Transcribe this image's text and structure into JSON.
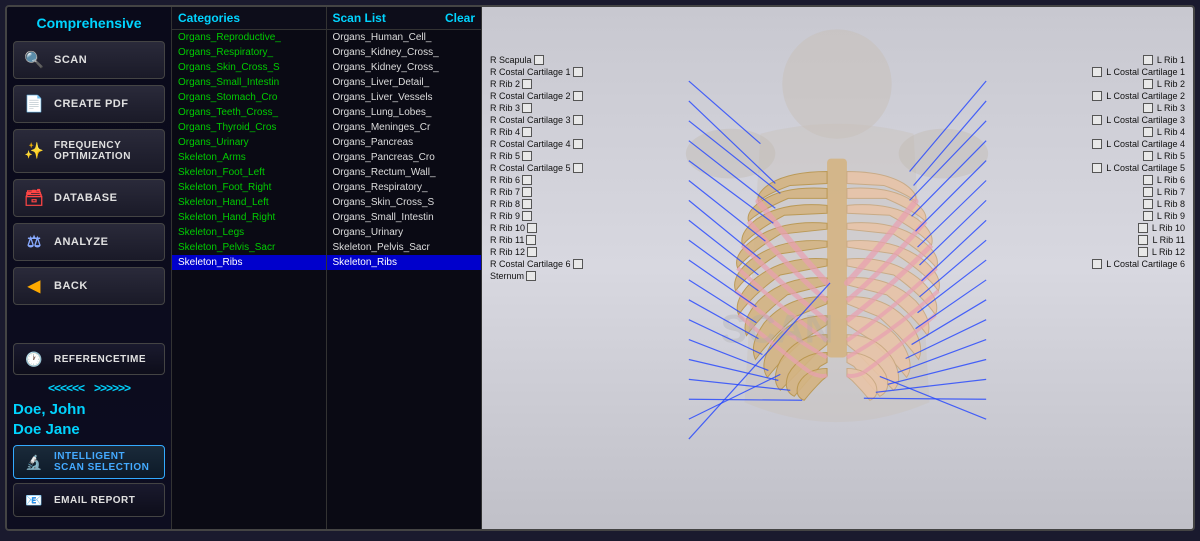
{
  "sidebar": {
    "title": "Comprehensive",
    "buttons": [
      {
        "id": "scan",
        "label": "SCAN",
        "icon": "🔍"
      },
      {
        "id": "create-pdf",
        "label": "CREATE PDF",
        "icon": "📄"
      },
      {
        "id": "frequency-optimization",
        "label": "FREQUENCY OPTIMIZATION",
        "icon": "✨"
      },
      {
        "id": "database",
        "label": "DATABASE",
        "icon": "🗃"
      },
      {
        "id": "analyze",
        "label": "ANALYZE",
        "icon": "⚖"
      },
      {
        "id": "back",
        "label": "BACK",
        "icon": "◀"
      }
    ],
    "reference_label": "REFERENCETIME",
    "arrows_left": "<<<<<<",
    "arrows_right": ">>>>>>",
    "patient1": "Doe, John",
    "patient2": "Doe Jane",
    "intelligent_scan_label": "INTELLIGENT SCAN SELECTION",
    "email_report_label": "EMAIL REPORT"
  },
  "categories": {
    "header": "Categories",
    "items": [
      "Organs_Reproductive_",
      "Organs_Respiratory_",
      "Organs_Skin_Cross_S",
      "Organs_Small_Intestin",
      "Organs_Stomach_Cro",
      "Organs_Teeth_Cross_",
      "Organs_Thyroid_Cros",
      "Organs_Urinary",
      "Skeleton_Arms",
      "Skeleton_Foot_Left",
      "Skeleton_Foot_Right",
      "Skeleton_Hand_Left",
      "Skeleton_Hand_Right",
      "Skeleton_Legs",
      "Skeleton_Pelvis_Sacr",
      "Skeleton_Ribs"
    ],
    "selected": "Skeleton_Ribs"
  },
  "scan_list": {
    "header": "Scan List",
    "clear_label": "Clear",
    "items": [
      "Organs_Human_Cell_",
      "Organs_Kidney_Cross_",
      "Organs_Kidney_Cross_",
      "Organs_Liver_Detail_",
      "Organs_Liver_Vessels",
      "Organs_Lung_Lobes_",
      "Organs_Meninges_Cr",
      "Organs_Pancreas",
      "Organs_Pancreas_Cro",
      "Organs_Rectum_Wall_",
      "Organs_Respiratory_",
      "Organs_Skin_Cross_S",
      "Organs_Small_Intestin",
      "Organs_Urinary",
      "Skeleton_Pelvis_Sacr",
      "Skeleton_Ribs"
    ],
    "selected": "Skeleton_Ribs"
  },
  "anatomy": {
    "scan_items_left": [
      {
        "name": "R Scapula"
      },
      {
        "name": "R Costal Cartilage 1"
      },
      {
        "name": "R Rib 2"
      },
      {
        "name": "R Costal Cartilage 2"
      },
      {
        "name": "R Rib 3"
      },
      {
        "name": "R Costal Cartilage 3"
      },
      {
        "name": "R Rib 4"
      },
      {
        "name": "R Costal Cartilage 4"
      },
      {
        "name": "R Rib 5"
      },
      {
        "name": "R Costal Cartilage 5"
      },
      {
        "name": "R Rib 6"
      },
      {
        "name": "R Rib 7"
      },
      {
        "name": "R Rib 8"
      },
      {
        "name": "R Rib 9"
      },
      {
        "name": "R Rib 10"
      },
      {
        "name": "R Rib 11"
      },
      {
        "name": "R Rib 12"
      },
      {
        "name": "R Costal Cartilage 6"
      },
      {
        "name": "Sternum"
      }
    ],
    "labels_right": [
      "L Rib 1",
      "L Costal Cartilage 1",
      "L Rib 2",
      "L Costal Cartilage 2",
      "L Rib 3",
      "L Costal Cartilage 3",
      "L Rib 4",
      "L Costal Cartilage 4",
      "L Rib 5",
      "L Costal Cartilage 5",
      "L Rib 6",
      "L Rib 7",
      "L Rib 8",
      "L Rib 9",
      "L Rib 10",
      "L Rib 11",
      "L Rib 12",
      "L Costal Cartilage 6"
    ]
  }
}
